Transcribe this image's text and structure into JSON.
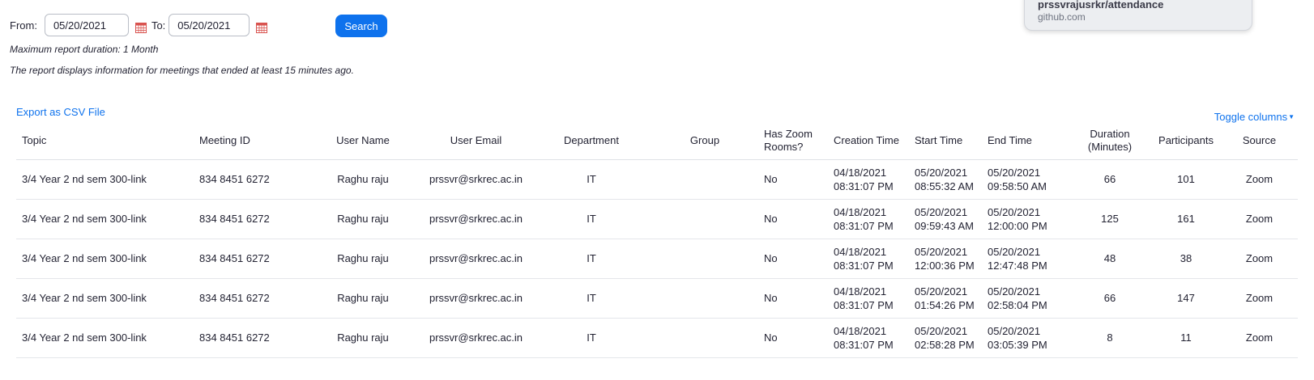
{
  "filters": {
    "from_label": "From:",
    "from_value": "05/20/2021",
    "to_label": "To:",
    "to_value": "05/20/2021",
    "search_label": "Search",
    "max_duration_note": "Maximum report duration: 1 Month",
    "info_note": "The report displays information for meetings that ended at least 15 minutes ago."
  },
  "toolbar": {
    "export_label": "Export as CSV File",
    "toggle_columns_label": "Toggle columns"
  },
  "popup": {
    "title": "prssvrajusrkr/attendance",
    "subtitle": "github.com"
  },
  "table": {
    "headers": {
      "topic": "Topic",
      "meeting_id": "Meeting ID",
      "user_name": "User Name",
      "user_email": "User Email",
      "department": "Department",
      "group": "Group",
      "has_zoom_rooms_1": "Has Zoom",
      "has_zoom_rooms_2": "Rooms?",
      "creation_time": "Creation Time",
      "start_time": "Start Time",
      "end_time": "End Time",
      "duration_1": "Duration",
      "duration_2": "(Minutes)",
      "participants": "Participants",
      "source": "Source"
    },
    "rows": [
      {
        "topic": "3/4 Year 2 nd sem 300-link",
        "meeting_id": "834 8451 6272",
        "user_name": "Raghu raju",
        "user_email": "prssvr@srkrec.ac.in",
        "department": "IT",
        "group": "",
        "has_zoom_rooms": "No",
        "creation_date": "04/18/2021",
        "creation_time": "08:31:07 PM",
        "start_date": "05/20/2021",
        "start_time": "08:55:32 AM",
        "end_date": "05/20/2021",
        "end_time": "09:58:50 AM",
        "duration": "66",
        "participants": "101",
        "source": "Zoom"
      },
      {
        "topic": "3/4 Year 2 nd sem 300-link",
        "meeting_id": "834 8451 6272",
        "user_name": "Raghu raju",
        "user_email": "prssvr@srkrec.ac.in",
        "department": "IT",
        "group": "",
        "has_zoom_rooms": "No",
        "creation_date": "04/18/2021",
        "creation_time": "08:31:07 PM",
        "start_date": "05/20/2021",
        "start_time": "09:59:43 AM",
        "end_date": "05/20/2021",
        "end_time": "12:00:00 PM",
        "duration": "125",
        "participants": "161",
        "source": "Zoom"
      },
      {
        "topic": "3/4 Year 2 nd sem 300-link",
        "meeting_id": "834 8451 6272",
        "user_name": "Raghu raju",
        "user_email": "prssvr@srkrec.ac.in",
        "department": "IT",
        "group": "",
        "has_zoom_rooms": "No",
        "creation_date": "04/18/2021",
        "creation_time": "08:31:07 PM",
        "start_date": "05/20/2021",
        "start_time": "12:00:36 PM",
        "end_date": "05/20/2021",
        "end_time": "12:47:48 PM",
        "duration": "48",
        "participants": "38",
        "source": "Zoom"
      },
      {
        "topic": "3/4 Year 2 nd sem 300-link",
        "meeting_id": "834 8451 6272",
        "user_name": "Raghu raju",
        "user_email": "prssvr@srkrec.ac.in",
        "department": "IT",
        "group": "",
        "has_zoom_rooms": "No",
        "creation_date": "04/18/2021",
        "creation_time": "08:31:07 PM",
        "start_date": "05/20/2021",
        "start_time": "01:54:26 PM",
        "end_date": "05/20/2021",
        "end_time": "02:58:04 PM",
        "duration": "66",
        "participants": "147",
        "source": "Zoom"
      },
      {
        "topic": "3/4 Year 2 nd sem 300-link",
        "meeting_id": "834 8451 6272",
        "user_name": "Raghu raju",
        "user_email": "prssvr@srkrec.ac.in",
        "department": "IT",
        "group": "",
        "has_zoom_rooms": "No",
        "creation_date": "04/18/2021",
        "creation_time": "08:31:07 PM",
        "start_date": "05/20/2021",
        "start_time": "02:58:28 PM",
        "end_date": "05/20/2021",
        "end_time": "03:05:39 PM",
        "duration": "8",
        "participants": "11",
        "source": "Zoom"
      }
    ]
  },
  "colors": {
    "accent": "#0e72ed",
    "text": "#232333",
    "calendar_icon": "#d9534f"
  }
}
